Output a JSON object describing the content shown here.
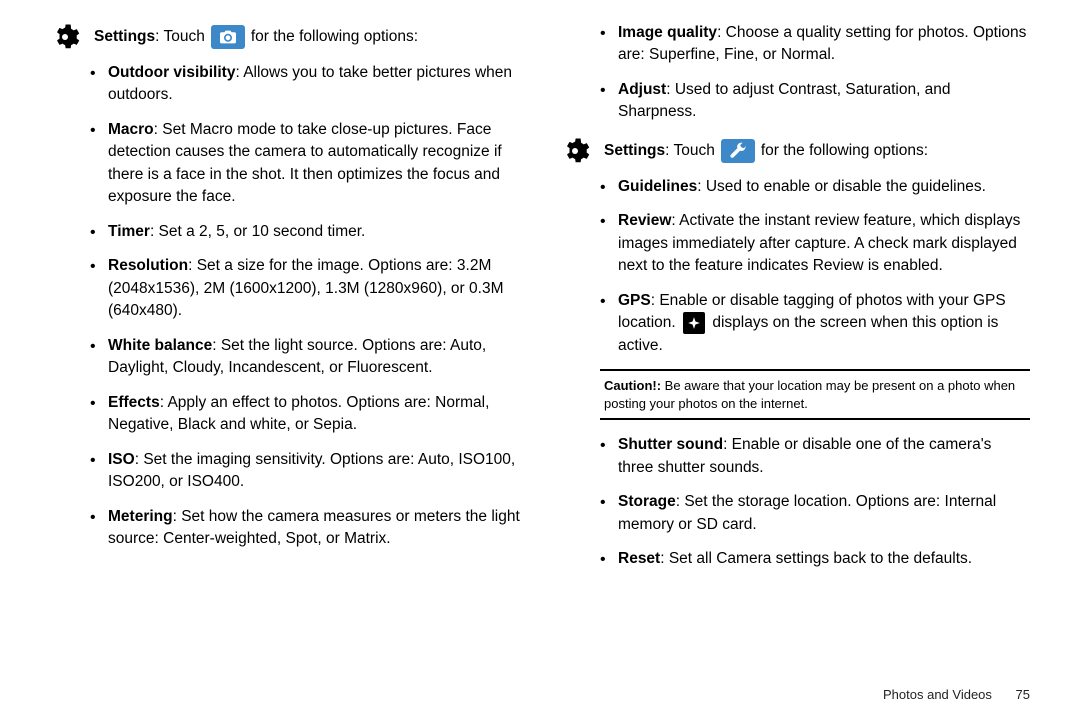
{
  "leftCol": {
    "introLabel": "Settings",
    "introSep": ": Touch",
    "introTail": "for the following options:",
    "items": [
      {
        "label": "Outdoor visibility",
        "text": ": Allows you to take better pictures when outdoors."
      },
      {
        "label": "Macro",
        "text": ": Set Macro mode to take close-up pictures. Face detection causes the camera to automatically recognize if there is a face in the shot. It then optimizes the focus and exposure the face."
      },
      {
        "label": "Timer",
        "text": ": Set a 2, 5, or 10 second timer."
      },
      {
        "label": "Resolution",
        "text": ": Set a size for the image. Options are: 3.2M (2048x1536), 2M (1600x1200), 1.3M (1280x960), or 0.3M (640x480)."
      },
      {
        "label": "White balance",
        "text": ": Set the light source. Options are: Auto, Daylight, Cloudy, Incandescent, or Fluorescent."
      },
      {
        "label": "Effects",
        "text": ": Apply an effect to photos. Options are: Normal, Negative, Black and white, or Sepia."
      },
      {
        "label": "ISO",
        "text": ": Set the imaging sensitivity. Options are: Auto, ISO100, ISO200, or ISO400."
      },
      {
        "label": "Metering",
        "text": ": Set how the camera measures or meters the light source: Center-weighted, Spot, or Matrix."
      }
    ]
  },
  "rightCol": {
    "topItems": [
      {
        "label": "Image quality",
        "text": ": Choose a quality setting for photos. Options are: Superfine, Fine, or Normal."
      },
      {
        "label": "Adjust",
        "text": ": Used to adjust Contrast, Saturation, and Sharpness."
      }
    ],
    "introLabel": "Settings",
    "introSep": ": Touch",
    "introTail": "for the following options:",
    "midItems": [
      {
        "label": "Guidelines",
        "text": ": Used to enable or disable the guidelines."
      },
      {
        "label": "Review",
        "text": ": Activate the instant review feature, which displays images immediately after capture. A check mark displayed next to the feature indicates Review is enabled."
      }
    ],
    "gpsItem": {
      "label": "GPS",
      "pre": ": Enable or disable tagging of photos with your GPS location. ",
      "post": " displays on the screen when this option is active."
    },
    "caution": {
      "label": "Caution!:",
      "text": " Be aware that your location may be present on a photo when posting your photos on the internet."
    },
    "lowItems": [
      {
        "label": "Shutter sound",
        "text": ": Enable or disable one of the camera's three shutter sounds."
      },
      {
        "label": "Storage",
        "text": ": Set the storage location. Options are: Internal memory or SD card."
      },
      {
        "label": "Reset",
        "text": ": Set all Camera settings back to the defaults."
      }
    ]
  },
  "footer": {
    "section": "Photos and Videos",
    "page": "75"
  }
}
